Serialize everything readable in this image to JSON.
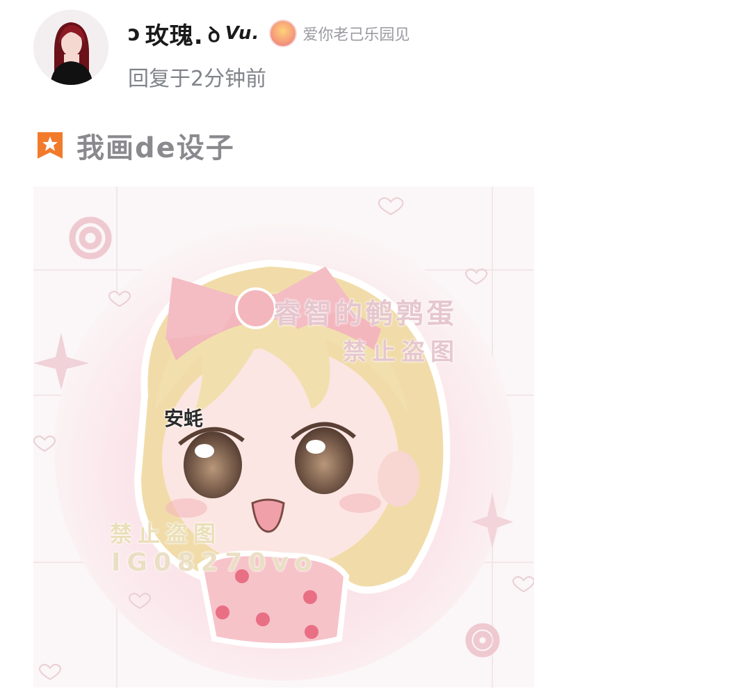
{
  "post": {
    "username": "玫瑰.",
    "username_suffix": "Vu.",
    "badge_text": "爱你老己乐园见",
    "reply_time": "回复于2分钟前"
  },
  "topic": {
    "title": "我画de设子",
    "icon": "star-bookmark-icon",
    "icon_color": "#f27a2b"
  },
  "image": {
    "watermark_author": "睿智的鹌鹑蛋",
    "watermark_notice_top": "禁止盗图",
    "character_label": "安蚝",
    "watermark_notice_bottom": "禁止盗图",
    "watermark_id": "IG08270vo"
  }
}
